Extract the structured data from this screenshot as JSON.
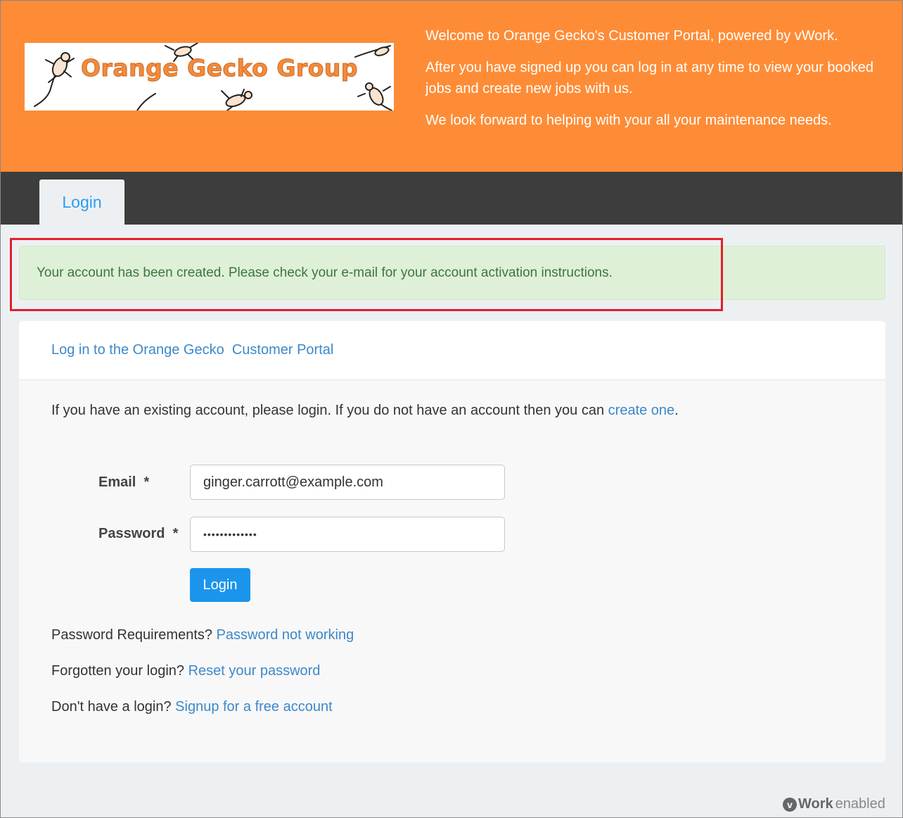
{
  "header": {
    "logo_text": "Orange Gecko Group",
    "welcome_lines": [
      "Welcome to Orange Gecko's Customer Portal, powered by vWork.",
      "After you have signed up you can log in at any time to view your booked jobs and create new jobs with us.",
      "We look forward to helping with your all your maintenance needs."
    ]
  },
  "nav": {
    "tabs": [
      {
        "label": "Login"
      }
    ]
  },
  "alert": {
    "message": "Your account has been created. Please check your e-mail for your account activation instructions."
  },
  "panel": {
    "title": "Log in to the Orange Gecko  Customer Portal",
    "intro_text": "If you have an existing account, please login. If you do not have an account then you can ",
    "intro_link": "create one",
    "intro_end": "."
  },
  "form": {
    "email_label": "Email",
    "password_label": "Password",
    "required_mark": "*",
    "email_value": "ginger.carrott@example.com",
    "password_value": "•••••••••••••",
    "login_button": "Login"
  },
  "help": [
    {
      "text": "Password Requirements? ",
      "link": "Password not working"
    },
    {
      "text": "Forgotten your login? ",
      "link": "Reset your password"
    },
    {
      "text": "Don't have a login? ",
      "link": "Signup for a free account"
    }
  ],
  "footer": {
    "badge": "v",
    "brand_bold": "Work",
    "brand_normal": "enabled"
  },
  "colors": {
    "header_bg": "#fe8c36",
    "navbar_bg": "#3d3d3d",
    "alert_bg": "#dff0d8",
    "alert_text": "#3c763d",
    "highlight_border": "#e0202a",
    "link": "#3d88c9",
    "button_bg": "#1b95ec"
  }
}
